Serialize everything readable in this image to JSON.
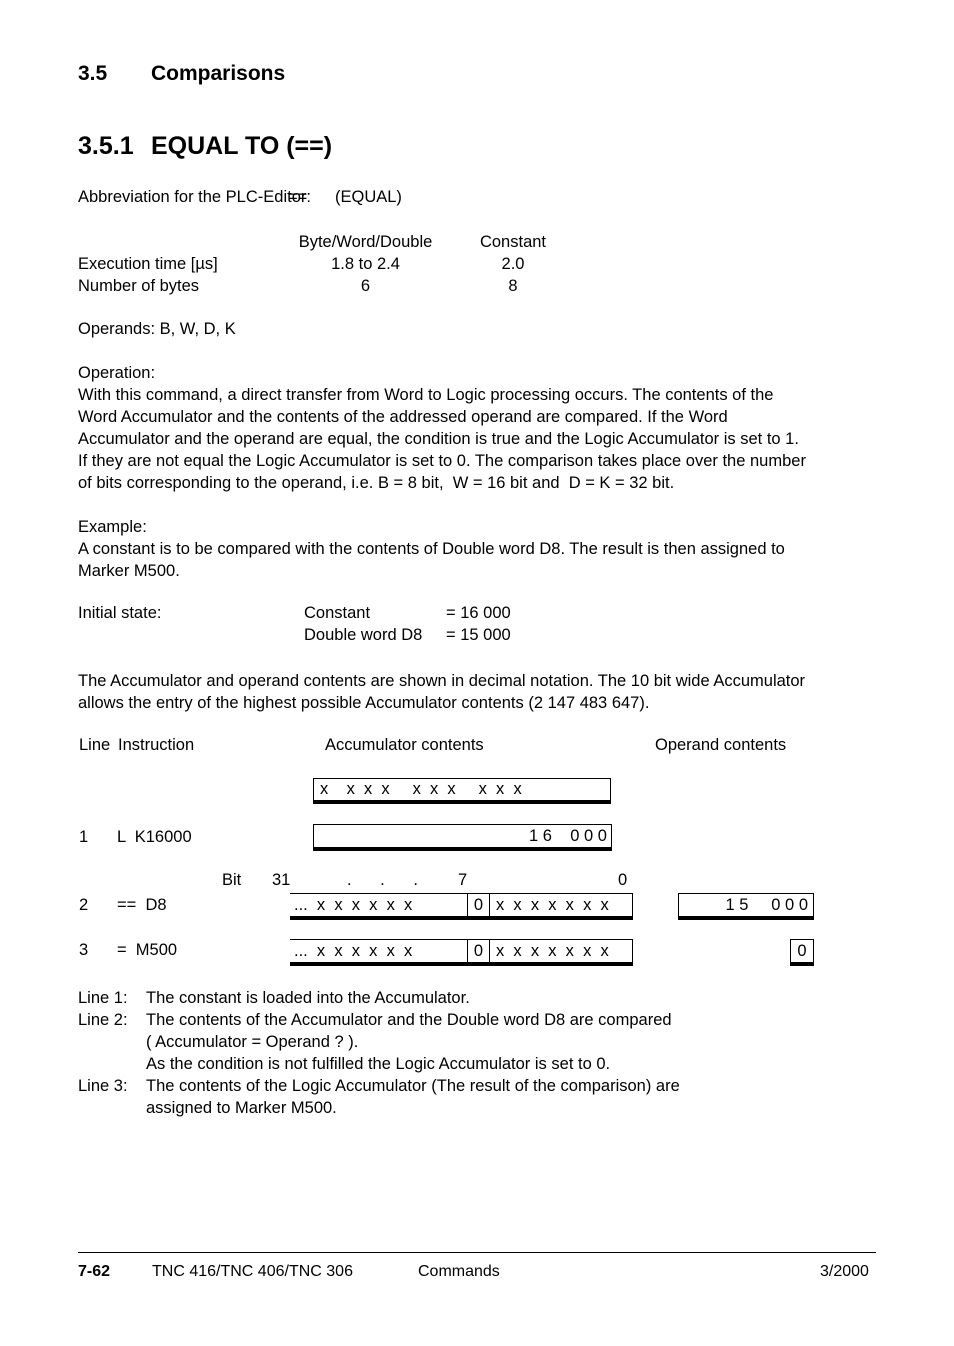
{
  "headings": {
    "section_number": "3.5",
    "section_title": "Comparisons",
    "subsection_number": "3.5.1",
    "subsection_title": "EQUAL TO  (==)"
  },
  "abbreviation": {
    "label": "Abbreviation for the PLC-Editor:",
    "operator": "==",
    "name": "(EQUAL)"
  },
  "spec_table": {
    "col_headers": [
      "",
      "Byte/Word/Double",
      "Constant"
    ],
    "rows": [
      {
        "label": "Execution time [µs]",
        "bwd": "1.8 to 2.4",
        "constant": "2.0"
      },
      {
        "label": "Number of bytes",
        "bwd": "6",
        "constant": "8"
      }
    ]
  },
  "operands_line": "Operands: B, W, D, K",
  "operation": {
    "heading": "Operation:",
    "body": "With this command, a direct transfer from Word to Logic processing occurs. The contents of the\nWord Accumulator and the contents of the addressed operand are compared. If the Word\nAccumulator and the operand are equal, the condition is true and the Logic Accumulator is set to 1.\nIf they are not equal the Logic Accumulator is set to 0. The comparison takes place over the number\nof bits corresponding to the operand, i.e. B = 8 bit,  W = 16 bit and  D = K = 32 bit."
  },
  "example": {
    "heading": "Example:",
    "body": "A constant is to be compared with the contents of Double word D8. The result is then assigned to\nMarker M500."
  },
  "initial_state": {
    "label": "Initial state:",
    "rows": [
      {
        "name": "Constant",
        "value": "= 16 000"
      },
      {
        "name": "Double word D8",
        "value": "= 15 000"
      }
    ]
  },
  "decimal_note": "The Accumulator and operand contents are shown in decimal notation. The 10 bit wide Accumulator\nallows the entry of the highest possible Accumulator contents (2 147 483 647).",
  "diagram": {
    "col_headers": {
      "line": "Line",
      "instruction": "Instruction",
      "accumulator": "Accumulator contents",
      "operand": "Operand contents"
    },
    "bit_scale": {
      "label": "Bit",
      "msb": "31",
      "dots": ". . .",
      "mid": "7",
      "lsb": "0"
    },
    "rows": [
      {
        "line": "",
        "instruction": "",
        "accumulator_pattern": "x    x  x  x     x  x  x     x  x  x",
        "operand": ""
      },
      {
        "line": "1",
        "instruction": "L  K16000",
        "accumulator_value": "1 6    0 0 0",
        "operand": ""
      },
      {
        "line": "2",
        "instruction": "==  D8",
        "accumulator_high": "...  x  x  x  x  x  x",
        "accumulator_bit": "0",
        "accumulator_low": "x  x  x  x  x  x  x",
        "operand": "1 5     0 0 0"
      },
      {
        "line": "3",
        "instruction": "=  M500",
        "accumulator_high": "...  x  x  x  x  x  x",
        "accumulator_bit": "0",
        "accumulator_low": "x  x  x  x  x  x  x",
        "operand": "0"
      }
    ]
  },
  "explanations": [
    {
      "tag": "Line 1:",
      "text": "The constant is loaded into the Accumulator."
    },
    {
      "tag": "Line 2:",
      "text": "The contents of the Accumulator and the Double word D8 are compared"
    },
    {
      "tag": "",
      "text": "( Accumulator = Operand ? )."
    },
    {
      "tag": "",
      "text": "As the condition is not fulfilled the Logic Accumulator is set to 0."
    },
    {
      "tag": "Line 3:",
      "text": "The contents of the Logic Accumulator (The result of the comparison) are"
    },
    {
      "tag": "",
      "text": "assigned to Marker M500."
    }
  ],
  "footer": {
    "page_number": "7-62",
    "product": "TNC 416/TNC 406/TNC 306",
    "chapter": "Commands",
    "date": "3/2000"
  }
}
